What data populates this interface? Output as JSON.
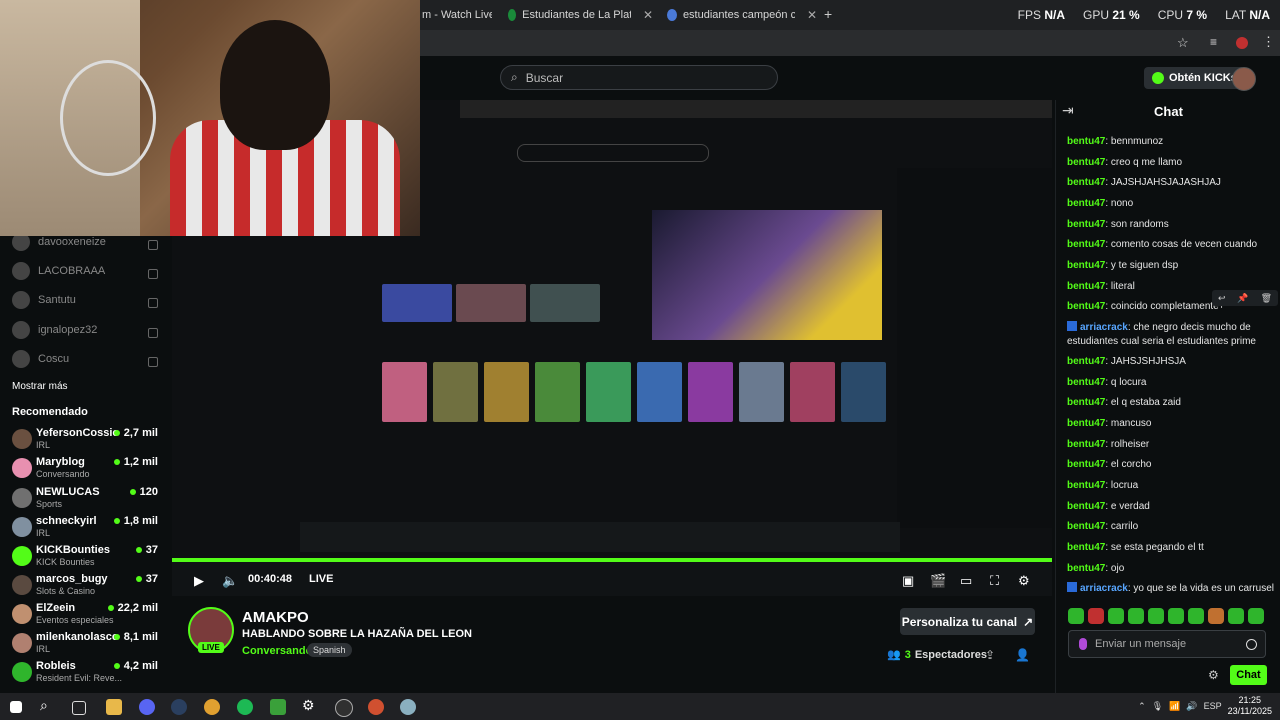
{
  "browser": {
    "tabs": [
      {
        "label": "m - Watch Live"
      },
      {
        "label": "Estudiantes de La Plata - Fixture"
      },
      {
        "label": "estudiantes campeón copa arg"
      }
    ],
    "new_tab": "+",
    "stats": {
      "fps_label": "FPS",
      "fps_value": "N/A",
      "gpu_label": "GPU",
      "gpu_value": "21 %",
      "cpu_label": "CPU",
      "cpu_value": "7 %",
      "lat_label": "LAT",
      "lat_value": "N/A"
    }
  },
  "header": {
    "search_placeholder": "Buscar",
    "get_kicks": "Obtén KICKs"
  },
  "sidebar": {
    "following": [
      {
        "name": "davooxeneize"
      },
      {
        "name": "LACOBRAAA"
      },
      {
        "name": "Santutu"
      },
      {
        "name": "ignalopez32"
      },
      {
        "name": "Coscu"
      }
    ],
    "show_more": "Mostrar más",
    "recommended_title": "Recomendado",
    "recommended": [
      {
        "name": "YefersonCossio",
        "category": "IRL",
        "viewers": "2,7 mil"
      },
      {
        "name": "Maryblog",
        "category": "Conversando",
        "viewers": "1,2 mil"
      },
      {
        "name": "NEWLUCAS",
        "category": "Sports",
        "viewers": "120"
      },
      {
        "name": "schneckyirl",
        "category": "IRL",
        "viewers": "1,8 mil"
      },
      {
        "name": "KICKBounties",
        "category": "KICK Bounties",
        "viewers": "37"
      },
      {
        "name": "marcos_bugy",
        "category": "Slots & Casino",
        "viewers": "37"
      },
      {
        "name": "ElZeein",
        "category": "Eventos especiales",
        "viewers": "22,2 mil"
      },
      {
        "name": "milenkanolasco",
        "category": "IRL",
        "viewers": "8,1 mil"
      },
      {
        "name": "Robleis",
        "category": "Resident Evil: Reve...",
        "viewers": "4,2 mil"
      }
    ]
  },
  "player": {
    "time": "00:40:48",
    "live": "LIVE",
    "progress": 1.0
  },
  "channel": {
    "name": "AMAKPO",
    "title": "HABLANDO SOBRE LA HAZAÑA DEL LEON",
    "category": "Conversando",
    "language": "Spanish",
    "live_badge": "LIVE",
    "customize": "Personaliza tu canal",
    "viewers_count": "3",
    "viewers_label": "Espectadores"
  },
  "chat": {
    "title": "Chat",
    "messages": [
      {
        "user": "bentu47",
        "text": "bennmunoz"
      },
      {
        "user": "bentu47",
        "text": "creo q me llamo"
      },
      {
        "user": "bentu47",
        "text": "JAJSHJAHSJAJASHJAJ"
      },
      {
        "user": "bentu47",
        "text": "nono"
      },
      {
        "user": "bentu47",
        "text": "son randoms"
      },
      {
        "user": "bentu47",
        "text": "comento cosas de vecen cuando"
      },
      {
        "user": "bentu47",
        "text": "y te siguen dsp"
      },
      {
        "user": "bentu47",
        "text": "literal"
      },
      {
        "user": "bentu47",
        "text": "coincido completamente+"
      },
      {
        "user": "arriacrack",
        "text": "che negro decis mucho de estudiantes cual seria el estudiantes prime"
      },
      {
        "user": "bentu47",
        "text": "JAHSJSHJHSJA"
      },
      {
        "user": "bentu47",
        "text": "q locura"
      },
      {
        "user": "bentu47",
        "text": "el q estaba zaid"
      },
      {
        "user": "bentu47",
        "text": "mancuso"
      },
      {
        "user": "bentu47",
        "text": "rolheiser"
      },
      {
        "user": "bentu47",
        "text": "el corcho"
      },
      {
        "user": "bentu47",
        "text": "locrua"
      },
      {
        "user": "bentu47",
        "text": "e verdad"
      },
      {
        "user": "bentu47",
        "text": "carrilo"
      },
      {
        "user": "bentu47",
        "text": "se esta pegando el tt"
      },
      {
        "user": "bentu47",
        "text": "ojo"
      },
      {
        "user": "arriacrack",
        "text": "yo que se la vida es un carrusel"
      }
    ],
    "input_placeholder": "Enviar un mensaje",
    "send_label": "Chat"
  },
  "taskbar": {
    "language": "ESP",
    "time": "21:25",
    "date": "23/11/2025"
  },
  "colors": {
    "accent": "#53fc18",
    "background": "#0b0e0f",
    "badge_blue": "#58a6ff"
  }
}
